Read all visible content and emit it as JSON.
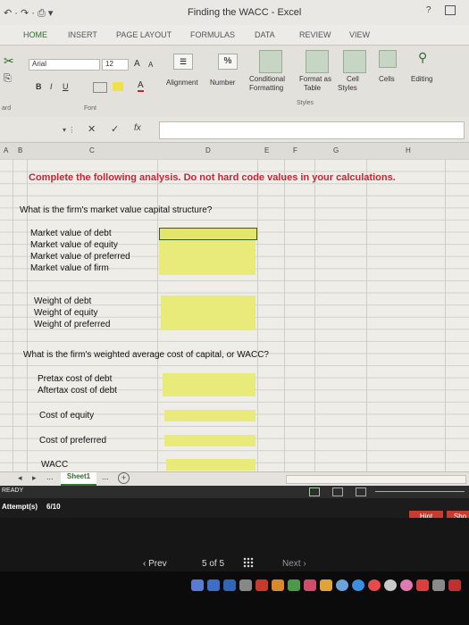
{
  "window": {
    "title": "Finding the WACC - Excel",
    "help_icon": "?"
  },
  "tabs": [
    "HOME",
    "INSERT",
    "PAGE LAYOUT",
    "FORMULAS",
    "DATA",
    "REVIEW",
    "VIEW"
  ],
  "ribbon": {
    "font_name": "Arial",
    "font_size": "12",
    "grow_font": "A",
    "shrink_font": "A",
    "bold": "B",
    "italic": "I",
    "underline": "U",
    "font_color": "A",
    "percent": "%",
    "alignment": "Alignment",
    "number": "Number",
    "conditional_formatting_1": "Conditional",
    "conditional_formatting_2": "Formatting",
    "format_as_table_1": "Format as",
    "format_as_table_2": "Table",
    "cell_styles_1": "Cell",
    "cell_styles_2": "Styles",
    "cells": "Cells",
    "editing": "Editing",
    "group_clipboard": "ard",
    "group_font": "Font",
    "group_styles": "Styles"
  },
  "formula_bar": {
    "cancel": "✕",
    "confirm": "✓",
    "fx": "fx",
    "value": ""
  },
  "columns": [
    "A",
    "B",
    "C",
    "D",
    "E",
    "F",
    "G",
    "H"
  ],
  "sheet": {
    "heading": "Complete the following analysis. Do not hard code values in your calculations.",
    "q1": "What is the firm's market value capital structure?",
    "mv_labels": [
      "Market value of debt",
      "Market value of equity",
      "Market value of preferred",
      "Market value of firm"
    ],
    "weight_labels": [
      "Weight of debt",
      "Weight of equity",
      "Weight of preferred"
    ],
    "q2": "What is the firm's weighted average cost of capital, or WACC?",
    "pretax": "Pretax cost of debt",
    "aftertax": "Aftertax cost of debt",
    "cost_equity": "Cost of equity",
    "cost_pref": "Cost of preferred",
    "wacc": "WACC"
  },
  "sheet_tabs": {
    "prev": "◂",
    "next": "▸",
    "more": "...",
    "active": "Sheet1",
    "more2": "...",
    "add": "+"
  },
  "status": {
    "ready": "READY"
  },
  "attempts": {
    "label": "Attempt(s)",
    "value": "6/10",
    "hint": "Hint",
    "show": "Sho"
  },
  "pager": {
    "prev": "‹ Prev",
    "page": "5 of 5",
    "next": "Next ›"
  },
  "colors": {
    "heading": "#c0283a",
    "yellow": "#e8ea7a",
    "hint": "#c73c31"
  }
}
